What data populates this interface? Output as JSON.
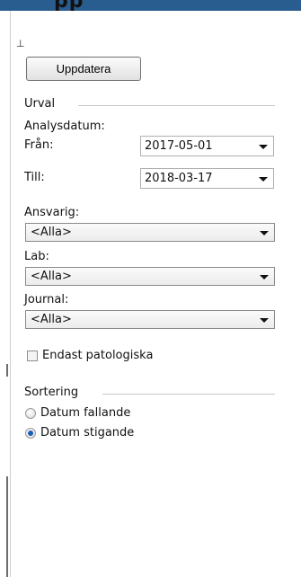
{
  "header": {
    "title_fragment": "pp"
  },
  "panel": {
    "pin_glyph": "⊥",
    "refresh_button": "Uppdatera",
    "selection_group": {
      "title": "Urval",
      "analysis_date_label": "Analysdatum:",
      "from_label": "Från:",
      "from_value": "2017-05-01",
      "to_label": "Till:",
      "to_value": "2018-03-17",
      "responsible_label": "Ansvarig:",
      "responsible_value": "<Alla>",
      "lab_label": "Lab:",
      "lab_value": "<Alla>",
      "journal_label": "Journal:",
      "journal_value": "<Alla>",
      "pathological_only_label": "Endast patologiska",
      "pathological_only_checked": false
    },
    "sort_group": {
      "title": "Sortering",
      "options": [
        {
          "label": "Datum fallande",
          "selected": false
        },
        {
          "label": "Datum stigande",
          "selected": true
        }
      ]
    }
  },
  "colors": {
    "top_bar": "#2a5d8f",
    "radio_selected": "#1c5fb5"
  }
}
